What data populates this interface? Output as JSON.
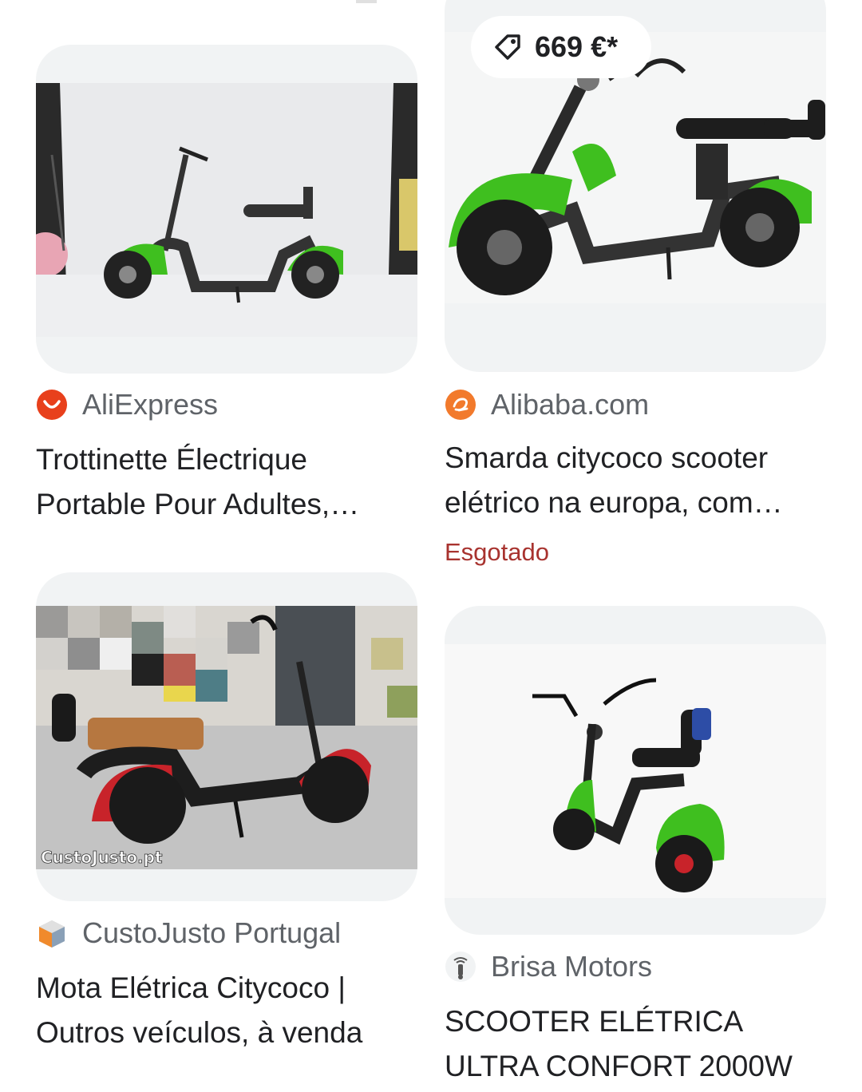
{
  "results": [
    {
      "source": "AliExpress",
      "title": "Trottinette Électrique Portable Pour Adultes, Scooter Électrique",
      "favicon": "aliexpress-icon",
      "accent": "#e8401c"
    },
    {
      "source": "Alibaba.com",
      "title": "Smarda citycoco scooter elétrico na europa, com bateria removível",
      "favicon": "alibaba-icon",
      "accent": "#f27a2c",
      "price": "669 €*",
      "status": "Esgotado"
    },
    {
      "source": "CustoJusto Portugal",
      "title": "Mota Elétrica Citycoco | Outros veículos, à venda",
      "favicon": "custojusto-icon",
      "watermark": "CustoJusto.pt"
    },
    {
      "source": "Brisa Motors",
      "title": "SCOOTER ELÉTRICA ULTRA CONFORT 2000W",
      "favicon": "brisa-motors-icon"
    }
  ],
  "colors": {
    "scooter_green": "#3fbf1f",
    "scooter_red": "#c8232a",
    "sold_out_red": "#a8332f",
    "card_bg": "#f1f3f4"
  }
}
